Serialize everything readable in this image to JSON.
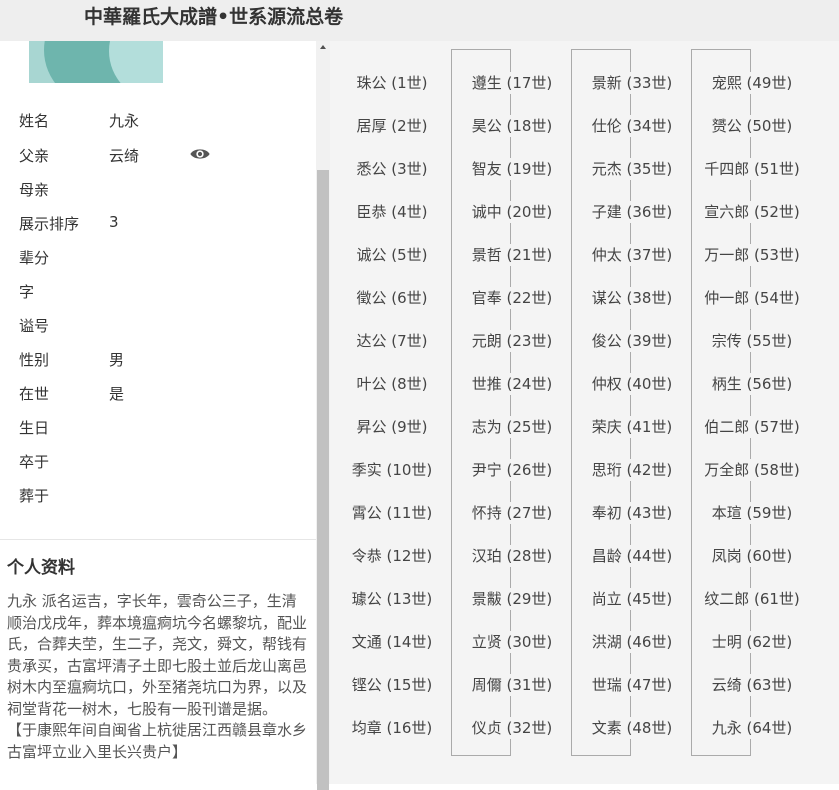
{
  "header": {
    "title": "中華羅氏大成譜•世系源流总卷"
  },
  "profile": {
    "fields": [
      {
        "label": "姓名",
        "value": "九永"
      },
      {
        "label": "父亲",
        "value": "云绮"
      },
      {
        "label": "母亲",
        "value": ""
      },
      {
        "label": "展示排序",
        "value": "3"
      },
      {
        "label": "辈分",
        "value": ""
      },
      {
        "label": "字",
        "value": ""
      },
      {
        "label": "谥号",
        "value": ""
      },
      {
        "label": "性别",
        "value": "男"
      },
      {
        "label": "在世",
        "value": "是"
      },
      {
        "label": "生日",
        "value": ""
      },
      {
        "label": "卒于",
        "value": ""
      },
      {
        "label": "葬于",
        "value": ""
      }
    ],
    "eye_icon": "eye-icon"
  },
  "bio": {
    "heading": "个人资料",
    "text": "九永 派名运吉，字长年，雲奇公三子，生清顺治戊戌年，葬本境瘟痾坑今名螺黎坑，配业氏，合葬夫茔，生二子，尧文，舜文，帮钱有贵承买，古富坪清子土即七股土並后龙山离邑树木内至瘟痾坑口，外至猪尧坑口为界，以及祠堂背花一树木，七股有一股刊谱是据。",
    "note": "【于康熙年间自闽省上杭徙居江西赣县章水乡古富坪立业入里长兴贵户】"
  },
  "generations": [
    [
      "珠公 (1世)",
      "居厚 (2世)",
      "悉公 (3世)",
      "臣恭 (4世)",
      "诚公 (5世)",
      "徵公 (6世)",
      "达公 (7世)",
      "叶公 (8世)",
      "昇公 (9世)",
      "季实 (10世)",
      "霄公 (11世)",
      "令恭 (12世)",
      "璩公 (13世)",
      "文通 (14世)",
      "铿公 (15世)",
      "均章 (16世)"
    ],
    [
      "遵生 (17世)",
      "昊公 (18世)",
      "智友 (19世)",
      "诚中 (20世)",
      "景哲 (21世)",
      "官奉 (22世)",
      "元朗 (23世)",
      "世推 (24世)",
      "志为 (25世)",
      "尹宁 (26世)",
      "怀持 (27世)",
      "汉珀 (28世)",
      "景黻 (29世)",
      "立贤 (30世)",
      "周儞 (31世)",
      "仪贞 (32世)"
    ],
    [
      "景新 (33世)",
      "仕伦 (34世)",
      "元杰 (35世)",
      "子建 (36世)",
      "仲太 (37世)",
      "谋公 (38世)",
      "俊公 (39世)",
      "仲权 (40世)",
      "荣庆 (41世)",
      "思珩 (42世)",
      "奉初 (43世)",
      "昌龄 (44世)",
      "尚立 (45世)",
      "洪湖 (46世)",
      "世瑞 (47世)",
      "文素 (48世)"
    ],
    [
      "宠熙 (49世)",
      "赟公 (50世)",
      "千四郎 (51世)",
      "宣六郎 (52世)",
      "万一郎 (53世)",
      "仲一郎 (54世)",
      "宗传 (55世)",
      "柄生 (56世)",
      "伯二郎 (57世)",
      "万全郎 (58世)",
      "本瑄 (59世)",
      "凤岗 (60世)",
      "纹二郎 (61世)",
      "士明 (62世)",
      "云绮 (63世)",
      "九永 (64世)"
    ]
  ]
}
